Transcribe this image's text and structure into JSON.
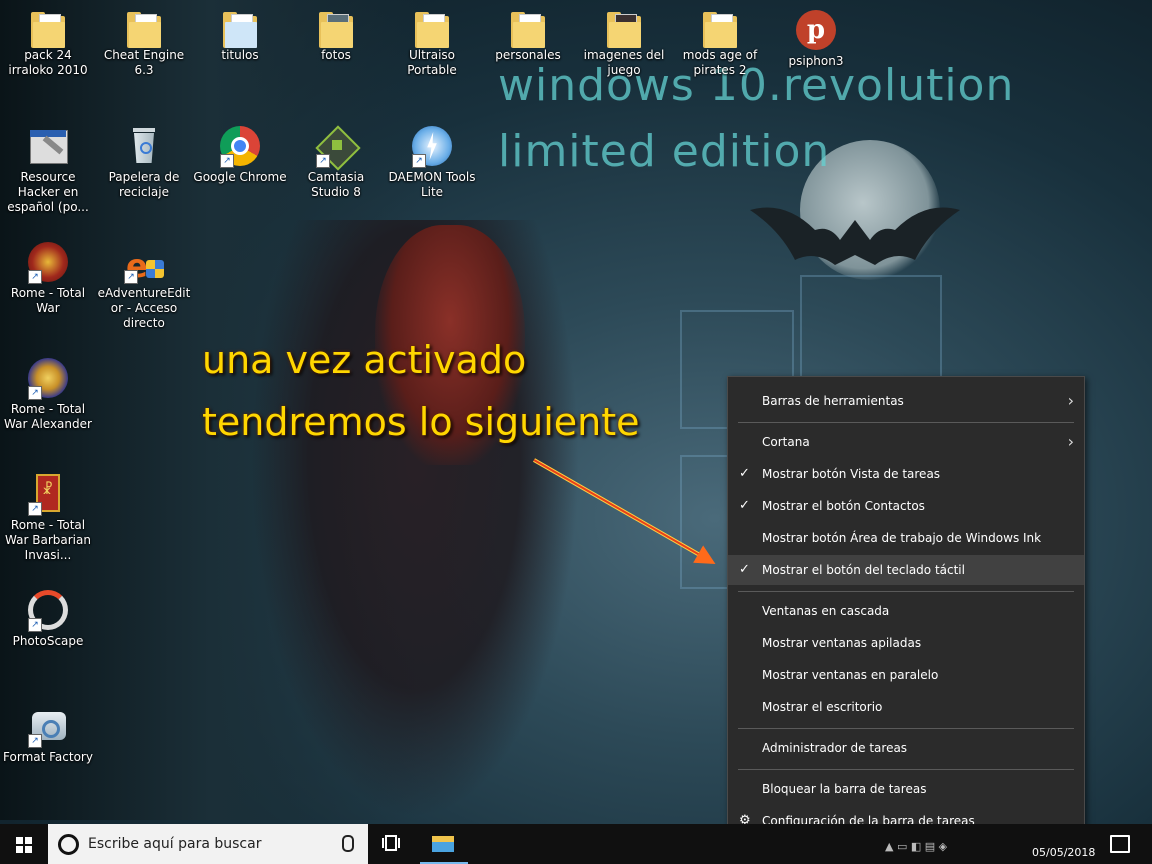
{
  "watermark": {
    "line1": "windows 10.revolution",
    "line2": "limited edition"
  },
  "annotation": {
    "line1": "una vez activado",
    "line2": "tendremos lo siguiente"
  },
  "desktop_icons": [
    {
      "label": "pack 24  irraloko 2010",
      "icon": "folder-icon"
    },
    {
      "label": "Cheat Engine 6.3",
      "icon": "folder-icon"
    },
    {
      "label": "titulos",
      "icon": "folder-icon"
    },
    {
      "label": "fotos",
      "icon": "folder-icon"
    },
    {
      "label": "Ultraiso Portable",
      "icon": "folder-icon"
    },
    {
      "label": "personales",
      "icon": "folder-icon"
    },
    {
      "label": "imagenes del juego",
      "icon": "folder-icon"
    },
    {
      "label": "mods age of pirates 2",
      "icon": "folder-icon"
    },
    {
      "label": "psiphon3",
      "icon": "psiphon-icon"
    },
    {
      "label": "Resource Hacker en español (po...",
      "icon": "resource-hacker-icon"
    },
    {
      "label": "Papelera de reciclaje",
      "icon": "recycle-bin-icon"
    },
    {
      "label": "Google Chrome",
      "icon": "chrome-icon"
    },
    {
      "label": "Camtasia Studio 8",
      "icon": "camtasia-icon"
    },
    {
      "label": "DAEMON Tools Lite",
      "icon": "daemon-tools-icon"
    },
    {
      "label": "Rome - Total War",
      "icon": "rome-icon"
    },
    {
      "label": "eAdventureEditor - Acceso directo",
      "icon": "eadventure-icon"
    },
    {
      "label": "Rome - Total War Alexander",
      "icon": "rome-alexander-icon"
    },
    {
      "label": "Rome - Total War Barbarian Invasi...",
      "icon": "rome-barbarian-icon"
    },
    {
      "label": "PhotoScape",
      "icon": "photoscape-icon"
    },
    {
      "label": "Format Factory",
      "icon": "format-factory-icon"
    }
  ],
  "context_menu": {
    "items": [
      {
        "label": "Barras de herramientas",
        "submenu": true,
        "checked": false
      },
      {
        "label": "Cortana",
        "submenu": true,
        "checked": false
      },
      {
        "label": "Mostrar botón Vista de tareas",
        "checked": true
      },
      {
        "label": "Mostrar el botón Contactos",
        "checked": true
      },
      {
        "label": "Mostrar botón Área de trabajo de Windows Ink",
        "checked": false
      },
      {
        "label": "Mostrar el botón del teclado táctil",
        "checked": true,
        "highlighted": true
      },
      {
        "label": "Ventanas en cascada",
        "checked": false
      },
      {
        "label": "Mostrar ventanas apiladas",
        "checked": false
      },
      {
        "label": "Mostrar ventanas en paralelo",
        "checked": false
      },
      {
        "label": "Mostrar el escritorio",
        "checked": false
      },
      {
        "label": "Administrador de tareas",
        "checked": false
      },
      {
        "label": "Bloquear la barra de tareas",
        "checked": false
      },
      {
        "label": "Configuración de la barra de tareas",
        "icon": "gear-icon"
      }
    ]
  },
  "taskbar": {
    "search_placeholder": "Escribe aquí para buscar",
    "date": "05/05/2018"
  },
  "colors": {
    "annotation": "#ffd700",
    "menu_bg": "#2b2b2b",
    "taskbar_bg": "#101010"
  }
}
